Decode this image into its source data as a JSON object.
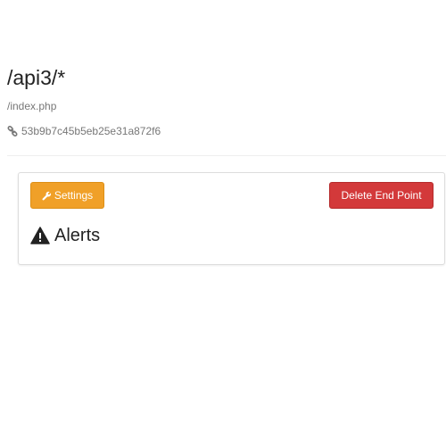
{
  "endpoint": {
    "path": "/api3/*",
    "file": "/index.php",
    "hash": "53b9b7c45b5eb25e31a872f6",
    "hash_icon": "link-icon"
  },
  "panel": {
    "settings_button": {
      "label": "Settings",
      "icon": "wrench-icon",
      "color": "#f0a028"
    },
    "delete_button": {
      "label": "Delete End Point",
      "color": "#d3393a"
    },
    "alerts_heading": {
      "label": "Alerts",
      "icon": "warning-icon"
    }
  }
}
